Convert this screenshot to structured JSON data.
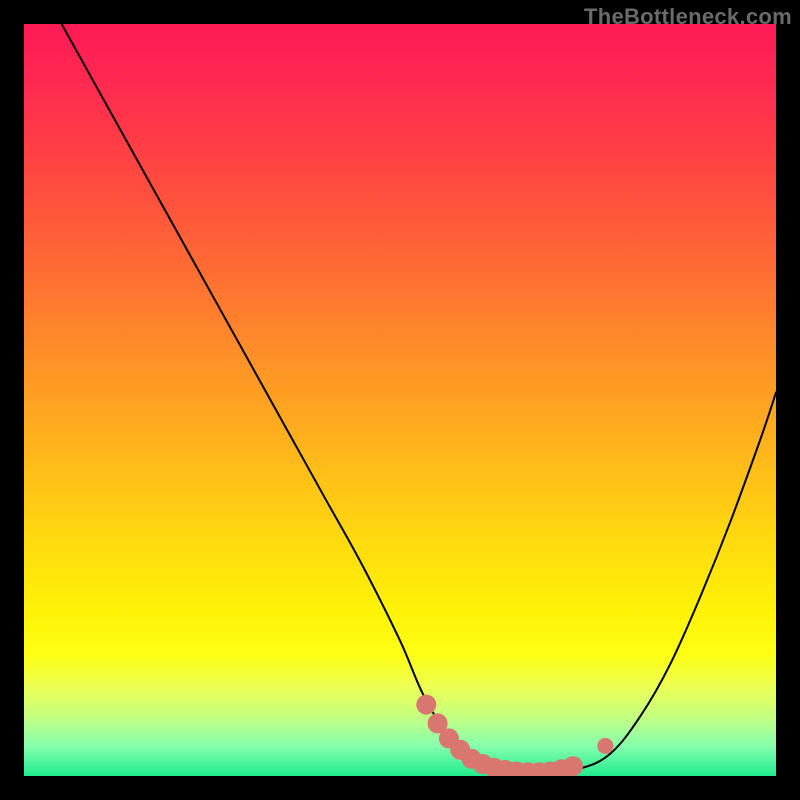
{
  "watermark": "TheBottleneck.com",
  "colors": {
    "page_bg": "#000000",
    "curve": "#000000",
    "marker_fill": "#d9766f",
    "marker_stroke": "#c75f58"
  },
  "chart_data": {
    "type": "line",
    "title": "",
    "xlabel": "",
    "ylabel": "",
    "xlim": [
      0,
      100
    ],
    "ylim": [
      0,
      100
    ],
    "series": [
      {
        "name": "bottleneck-curve",
        "x": [
          5,
          10,
          15,
          20,
          25,
          30,
          35,
          40,
          45,
          50,
          53,
          56,
          59,
          63,
          67,
          70,
          74,
          78,
          82,
          86,
          90,
          94,
          98,
          100
        ],
        "y": [
          100,
          91,
          82,
          73,
          64,
          55,
          46,
          37,
          28,
          18,
          11,
          6,
          3,
          1,
          0.5,
          0.5,
          1,
          3,
          8,
          15,
          24,
          34,
          45,
          51
        ]
      }
    ],
    "markers": [
      {
        "x": 53.5,
        "y": 9.5
      },
      {
        "x": 55.0,
        "y": 7.0
      },
      {
        "x": 56.5,
        "y": 5.0
      },
      {
        "x": 58.0,
        "y": 3.5
      },
      {
        "x": 59.5,
        "y": 2.3
      },
      {
        "x": 61.0,
        "y": 1.6
      },
      {
        "x": 62.5,
        "y": 1.1
      },
      {
        "x": 64.0,
        "y": 0.8
      },
      {
        "x": 65.5,
        "y": 0.6
      },
      {
        "x": 67.0,
        "y": 0.5
      },
      {
        "x": 68.5,
        "y": 0.5
      },
      {
        "x": 70.0,
        "y": 0.6
      },
      {
        "x": 71.5,
        "y": 0.9
      },
      {
        "x": 73.0,
        "y": 1.3
      },
      {
        "x": 77.3,
        "y": 4.0
      }
    ]
  }
}
